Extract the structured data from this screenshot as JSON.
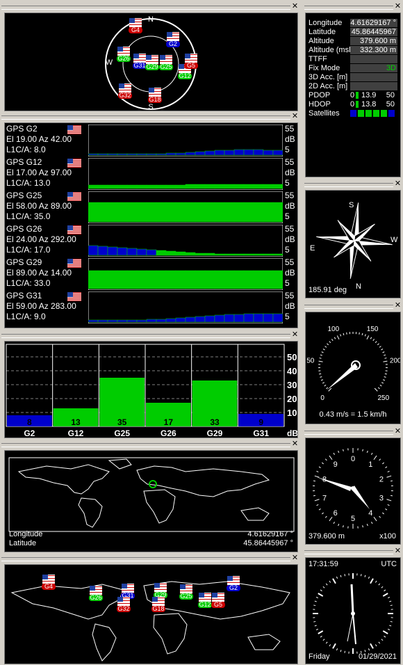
{
  "sky": {
    "north": "N",
    "south": "S",
    "west": "W",
    "sats": [
      {
        "id": "G4",
        "color": "red"
      },
      {
        "id": "G2",
        "color": "blue"
      },
      {
        "id": "G26",
        "color": "green"
      },
      {
        "id": "G31",
        "color": "blue"
      },
      {
        "id": "G29",
        "color": "green"
      },
      {
        "id": "G25",
        "color": "green"
      },
      {
        "id": "G12",
        "color": "green"
      },
      {
        "id": "G5",
        "color": "red"
      },
      {
        "id": "G32",
        "color": "red"
      },
      {
        "id": "G18",
        "color": "red"
      }
    ]
  },
  "info": {
    "rows": [
      {
        "k": "Longitude",
        "v": "4.61629167 °"
      },
      {
        "k": "Latitude",
        "v": "45.86445967 °"
      },
      {
        "k": "Altitude",
        "v": "379.600 m"
      },
      {
        "k": "Altitude (msl)",
        "v": "332.300 m"
      },
      {
        "k": "TTFF",
        "v": ""
      },
      {
        "k": "Fix Mode",
        "v": "3D"
      },
      {
        "k": "3D Acc. [m]",
        "v": ""
      },
      {
        "k": "2D Acc. [m]",
        "v": ""
      }
    ],
    "pdop": {
      "label": "PDOP",
      "min": "0",
      "val": "13.9",
      "max": "50"
    },
    "hdop": {
      "label": "HDOP",
      "min": "0",
      "val": "13.8",
      "max": "50"
    },
    "satellites_label": "Satellites",
    "satellites_count": 6
  },
  "signals": [
    {
      "name": "GPS G2",
      "pos": "El 19.00 Az 42.00",
      "l1": "L1C/A: 8.0",
      "top": "55",
      "unit": "dB",
      "bot": "5",
      "fill": "blue"
    },
    {
      "name": "GPS G12",
      "pos": "El 17.00 Az 97.00",
      "l1": "L1C/A: 13.0",
      "top": "55",
      "unit": "dB",
      "bot": "5",
      "fill": "green"
    },
    {
      "name": "GPS G25",
      "pos": "El 58.00 Az 89.00",
      "l1": "L1C/A: 35.0",
      "top": "55",
      "unit": "dB",
      "bot": "5",
      "fill": "green"
    },
    {
      "name": "GPS G26",
      "pos": "El 24.00 Az 292.00",
      "l1": "L1C/A: 17.0",
      "top": "55",
      "unit": "dB",
      "bot": "5",
      "fill": "green"
    },
    {
      "name": "GPS G29",
      "pos": "El 89.00 Az 14.00",
      "l1": "L1C/A: 33.0",
      "top": "55",
      "unit": "dB",
      "bot": "5",
      "fill": "green"
    },
    {
      "name": "GPS G31",
      "pos": "El 59.00 Az 283.00",
      "l1": "L1C/A: 9.0",
      "top": "55",
      "unit": "dB",
      "bot": "5",
      "fill": "blue"
    }
  ],
  "chart_data": {
    "type": "bar",
    "categories": [
      "G2",
      "G12",
      "G25",
      "G26",
      "G29",
      "G31"
    ],
    "values": [
      8,
      13,
      35,
      17,
      33,
      9
    ],
    "colors": [
      "blue",
      "green",
      "green",
      "green",
      "green",
      "blue"
    ],
    "ylim": [
      0,
      55
    ],
    "yticks": [
      "50",
      "40",
      "30",
      "20",
      "10"
    ],
    "ylabel": "dB"
  },
  "worldmap": {
    "lon_label": "Longitude",
    "lon_val": "4.61629167 °",
    "lat_label": "Latitude",
    "lat_val": "45.86445967 °"
  },
  "compass": {
    "heading": "185.91 deg",
    "n": "N",
    "s": "S",
    "e": "E",
    "w": "W"
  },
  "speed": {
    "ticks": [
      "0",
      "50",
      "100",
      "150",
      "200",
      "250"
    ],
    "text": "0.43 m/s = 1.5 km/h"
  },
  "altimeter": {
    "ticks": [
      "0",
      "1",
      "2",
      "3",
      "4",
      "5",
      "6",
      "7",
      "8",
      "9"
    ],
    "alt": "379.600 m",
    "mult": "x100"
  },
  "clock": {
    "time": "17:31:59",
    "tz": "UTC",
    "day": "Friday",
    "date": "01/29/2021"
  },
  "colors": {
    "green": "#00cc00",
    "blue": "#0000cc",
    "red": "#cc0000",
    "bg": "#d4d0c8"
  }
}
